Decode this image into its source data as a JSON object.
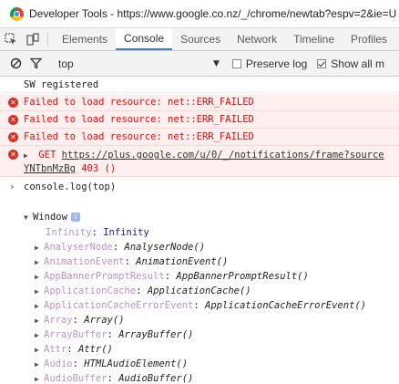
{
  "window": {
    "title": "Developer Tools - https://www.google.co.nz/_/chrome/newtab?espv=2&ie=U"
  },
  "tabs": [
    "Elements",
    "Console",
    "Sources",
    "Network",
    "Timeline",
    "Profiles"
  ],
  "active_tab": "Console",
  "filter": {
    "context": "top",
    "preserve_log_label": "Preserve log",
    "show_all_label": "Show all m",
    "preserve_log_checked": false,
    "show_all_checked": true
  },
  "console": {
    "sw_message": "SW registered",
    "errors": [
      "Failed to load resource: net::ERR_FAILED",
      "Failed to load resource: net::ERR_FAILED",
      "Failed to load resource: net::ERR_FAILED"
    ],
    "get_error": {
      "method": "GET",
      "url": "https://plus.google.com/u/0/_/notifications/frame?source",
      "url_cont": "YNTbnMzBg",
      "status": "403 ()"
    },
    "command": "console.log(top)",
    "window_label": "Window",
    "window_badge": "i",
    "infinity_key": "Infinity",
    "infinity_value": "Infinity",
    "properties": [
      {
        "key": "AnalyserNode",
        "value": "AnalyserNode()"
      },
      {
        "key": "AnimationEvent",
        "value": "AnimationEvent()"
      },
      {
        "key": "AppBannerPromptResult",
        "value": "AppBannerPromptResult()"
      },
      {
        "key": "ApplicationCache",
        "value": "ApplicationCache()"
      },
      {
        "key": "ApplicationCacheErrorEvent",
        "value": "ApplicationCacheErrorEvent()"
      },
      {
        "key": "Array",
        "value": "Array()"
      },
      {
        "key": "ArrayBuffer",
        "value": "ArrayBuffer()"
      },
      {
        "key": "Attr",
        "value": "Attr()"
      },
      {
        "key": "Audio",
        "value": "HTMLAudioElement()"
      },
      {
        "key": "AudioBuffer",
        "value": "AudioBuffer()"
      }
    ]
  },
  "colors": {
    "error_text": "#ff0000",
    "error_bg": "#fff0f0",
    "active_tab_underline": "#3879d9"
  }
}
